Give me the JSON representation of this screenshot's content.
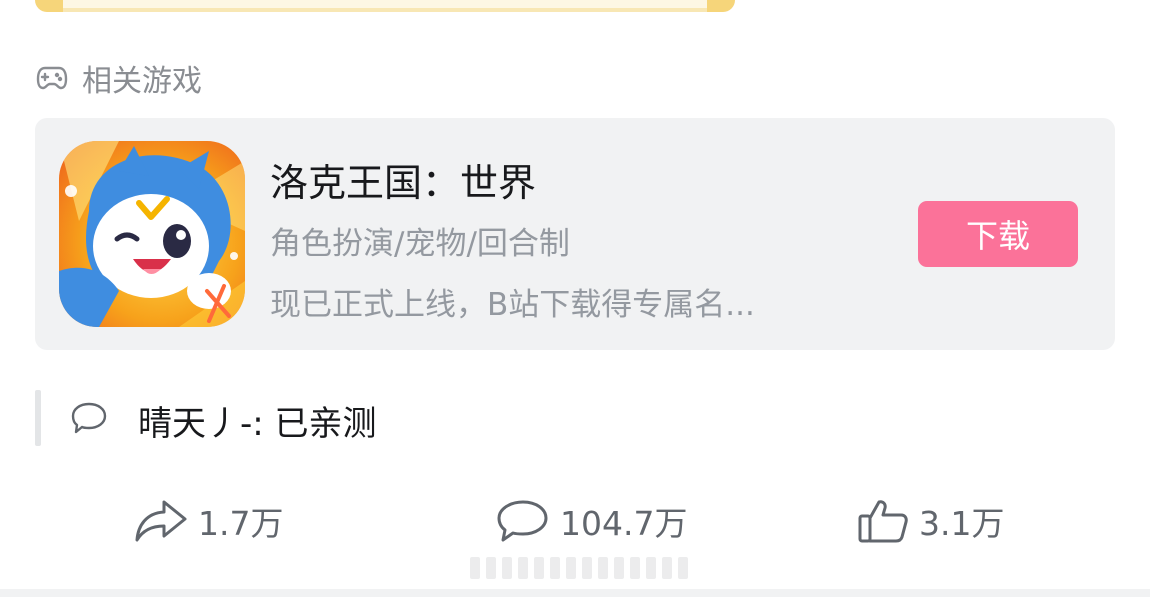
{
  "section": {
    "label": "相关游戏",
    "icon": "gamepad-icon"
  },
  "game": {
    "title": "洛克王国：世界",
    "tags": "角色扮演/宠物/回合制",
    "description": "现已正式上线，B站下载得专属名...",
    "download_label": "下载",
    "accent_color": "#fb7299"
  },
  "comment": {
    "icon": "comment-bubble-icon",
    "text": "晴天丿-: 已亲测"
  },
  "actions": {
    "share": {
      "icon": "share-icon",
      "count": "1.7万"
    },
    "comment": {
      "icon": "comment-icon",
      "count": "104.7万"
    },
    "like": {
      "icon": "thumbs-up-icon",
      "count": "3.1万"
    }
  }
}
